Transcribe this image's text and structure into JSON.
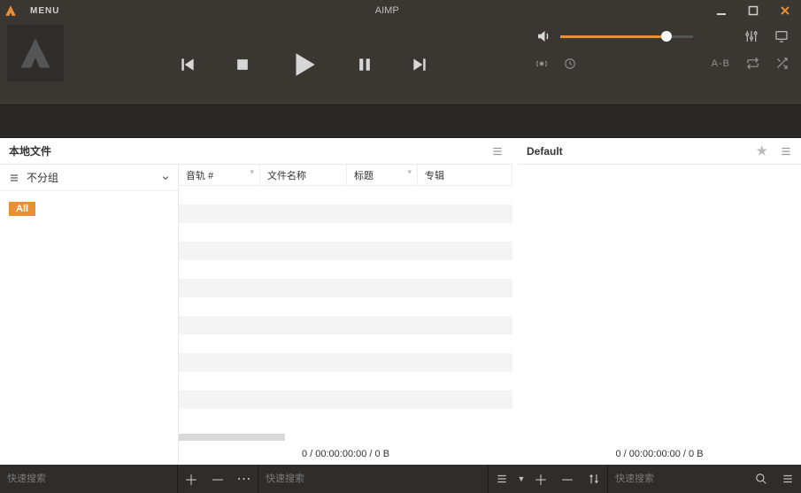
{
  "titlebar": {
    "menu_label": "MENU",
    "app_title": "AIMP"
  },
  "player": {
    "ab_label": "A-B"
  },
  "left_pane": {
    "tab_label": "本地文件",
    "group_dropdown": "不分组",
    "filter_badge": "All",
    "columns": [
      "音轨 #",
      "文件名称",
      "标题",
      "专辑"
    ],
    "status": "0 / 00:00:00:00 / 0 B"
  },
  "right_pane": {
    "tab_label": "Default",
    "status": "0 / 00:00:00:00 / 0 B"
  },
  "bottombar": {
    "search_placeholder": "快速搜索"
  }
}
